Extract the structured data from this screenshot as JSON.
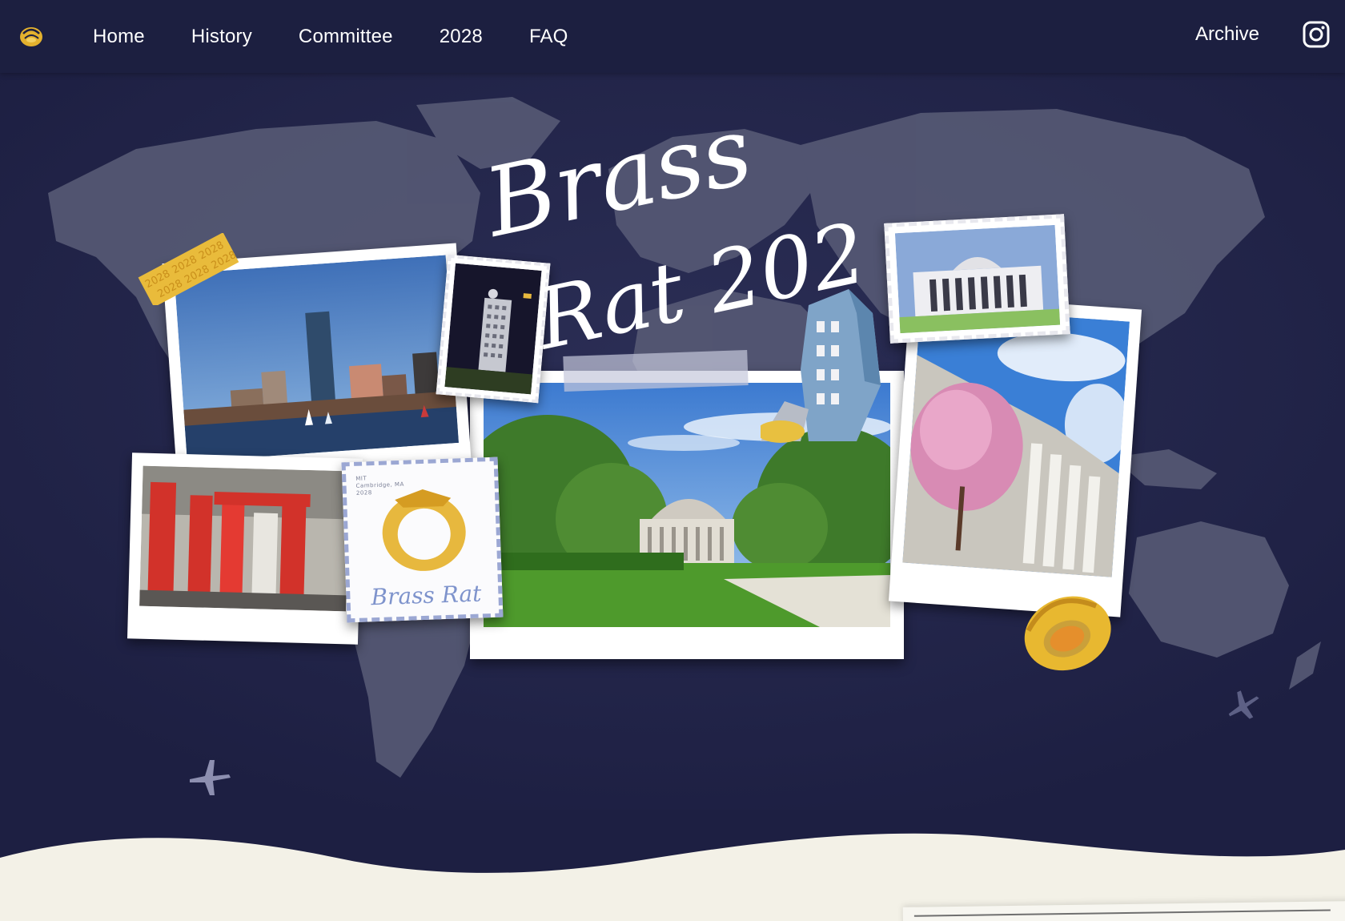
{
  "nav": {
    "logo_icon": "brass-rat-logo-icon",
    "links": [
      {
        "label": "Home"
      },
      {
        "label": "History"
      },
      {
        "label": "Committee"
      },
      {
        "label": "2028"
      },
      {
        "label": "FAQ"
      }
    ],
    "archive_label": "Archive",
    "instagram_icon": "instagram-icon"
  },
  "hero": {
    "title_line1": "Brass",
    "title_line2": "Rat 2028",
    "stamp": {
      "small_text_line1": "MIT",
      "small_text_line2": "Cambridge, MA",
      "small_text_line3": "2028",
      "script_text": "Brass Rat"
    },
    "tape_pattern_text": "2028"
  },
  "colors": {
    "nav_bg": "#1c1f40",
    "hero_bg": "#1d1f42",
    "continent": "#545773",
    "cream": "#f3f1e7",
    "gold": "#e8b830"
  }
}
